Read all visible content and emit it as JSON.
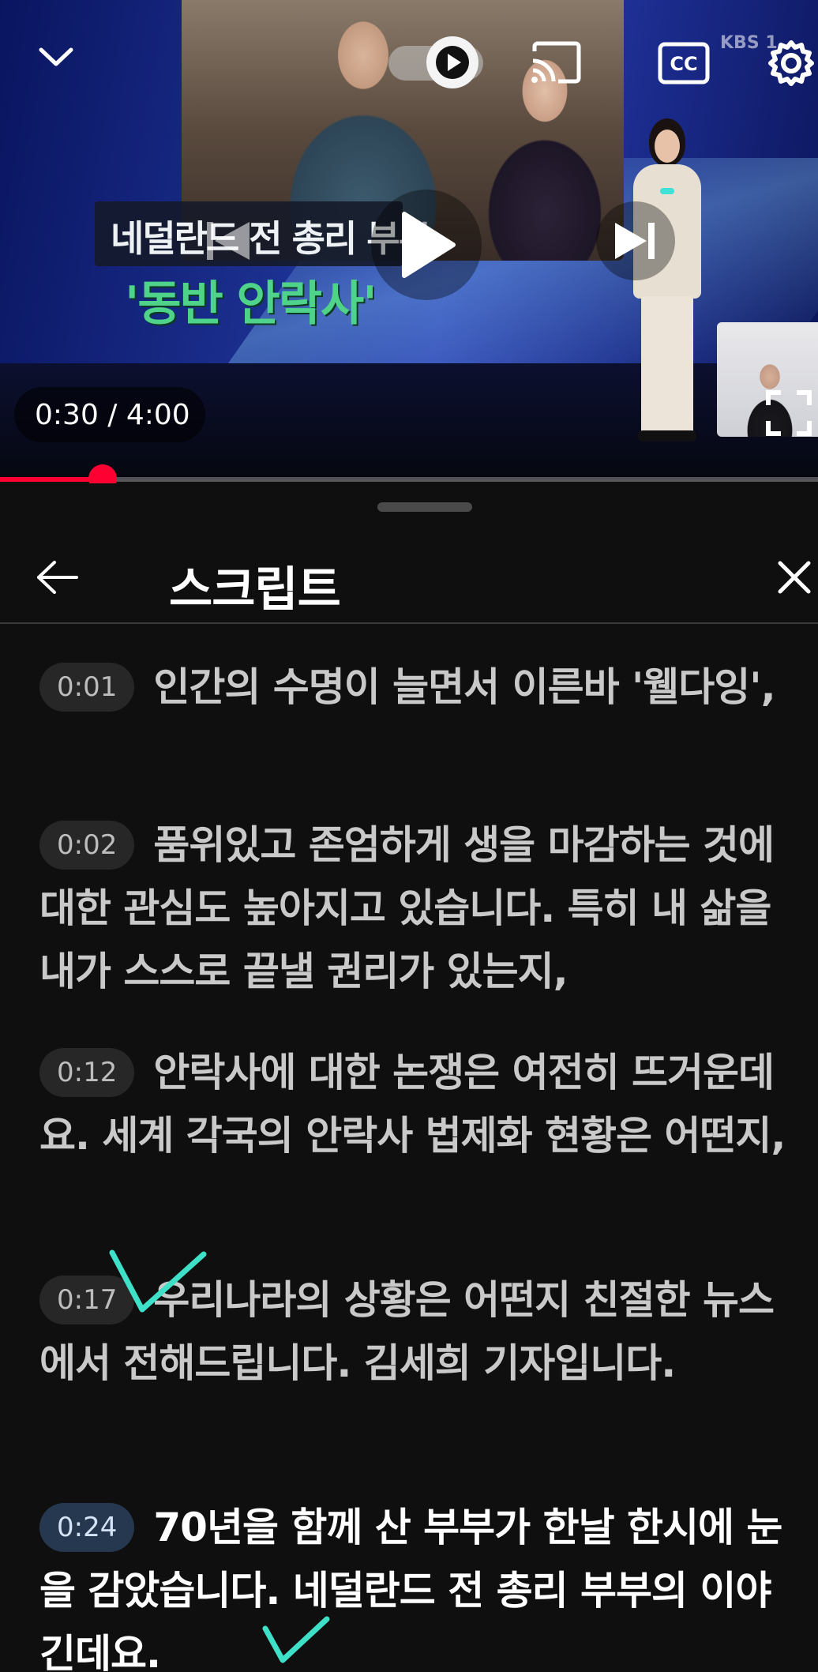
{
  "player": {
    "channel_logo": "KBS 1",
    "headline": "네덜란드 전 총리 부부",
    "subheadline": "'동반 안락사'",
    "current_time": "0:30",
    "duration": "4:00",
    "time_display": "0:30 / 4:00",
    "progress_fraction": 0.125,
    "autoplay_on": true,
    "accent_color": "#ff0033",
    "icons": [
      "chevron-down-icon",
      "autoplay-icon",
      "cast-icon",
      "cc-icon",
      "gear-icon",
      "previous-icon",
      "play-icon",
      "next-icon",
      "fullscreen-icon"
    ]
  },
  "transcript": {
    "title": "스크립트",
    "icons": [
      "back-arrow-icon",
      "close-icon"
    ],
    "segments": [
      {
        "time": "0:01",
        "text": "인간의 수명이 늘면서 이른바 '웰다잉',",
        "active": false
      },
      {
        "time": "0:02",
        "text": "품위있고 존엄하게 생을 마감하는 것에 대한 관심도 높아지고 있습니다. 특히 내 삶을 내가 스스로 끝낼 권리가 있는지,",
        "active": false
      },
      {
        "time": "0:12",
        "text": "안락사에 대한 논쟁은 여전히 뜨거운데요. 세계 각국의 안락사 법제화 현황은 어떤지,",
        "active": false
      },
      {
        "time": "0:17",
        "text": "우리나라의 상황은 어떤지 친절한 뉴스에서 전해드립니다. 김세희 기자입니다.",
        "active": false
      },
      {
        "time": "0:24",
        "text": "70년을 함께 산 부부가 한날 한시에 눈을 감았습니다. 네덜란드 전 총리 부부의 이야긴데요.",
        "active": true
      }
    ],
    "annotation_color": "#3fe0c8"
  }
}
